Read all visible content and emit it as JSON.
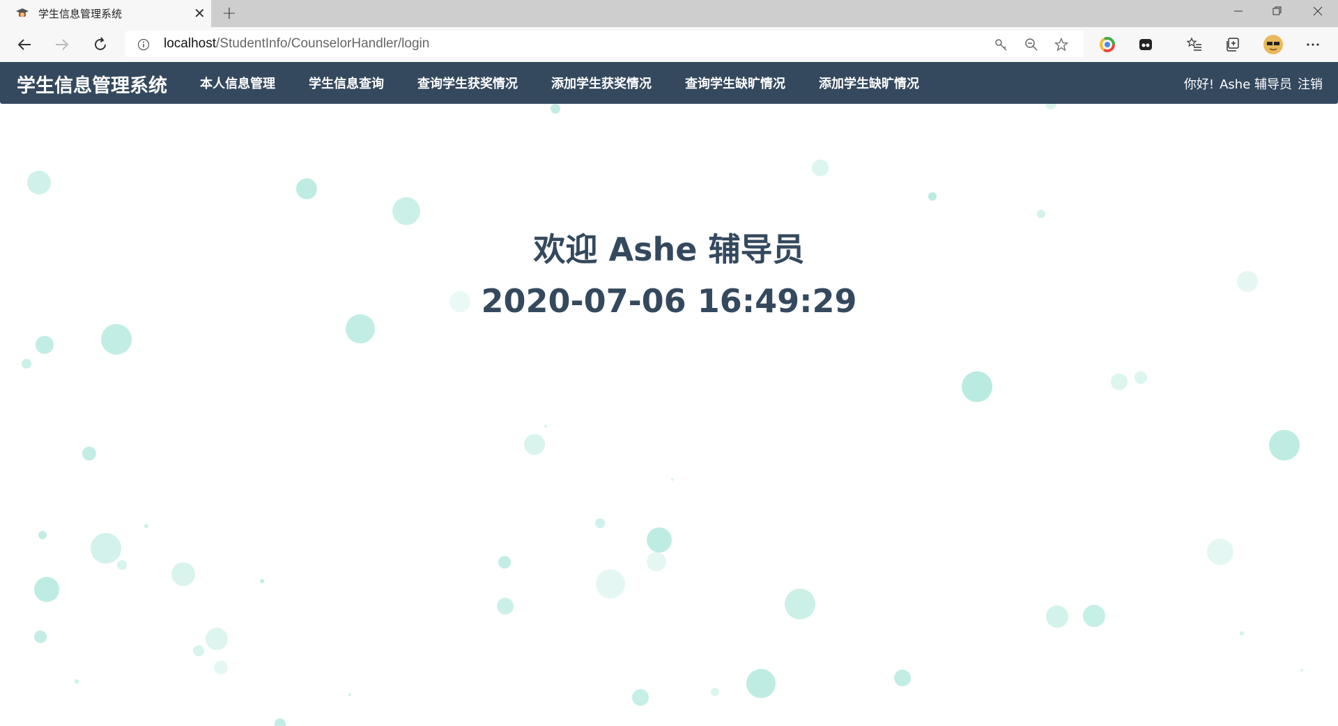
{
  "browser": {
    "tab_title": "学生信息管理系统",
    "tab_favicon": "graduation-cap-icon",
    "url_host": "localhost",
    "url_path": "/StudentInfo/CounselorHandler/login"
  },
  "navbar": {
    "brand": "学生信息管理系统",
    "items": [
      {
        "label": "本人信息管理"
      },
      {
        "label": "学生信息查询"
      },
      {
        "label": "查询学生获奖情况"
      },
      {
        "label": "添加学生获奖情况"
      },
      {
        "label": "查询学生缺旷情况"
      },
      {
        "label": "添加学生缺旷情况"
      }
    ],
    "greeting": "你好!",
    "username": "Ashe 辅导员",
    "logout": "注销",
    "background": "#34495e"
  },
  "main": {
    "welcome": "欢迎 Ashe 辅导员",
    "datetime": "2020-07-06 16:49:29",
    "text_color": "#34495e",
    "bubble_color": "#a8e6d8"
  }
}
